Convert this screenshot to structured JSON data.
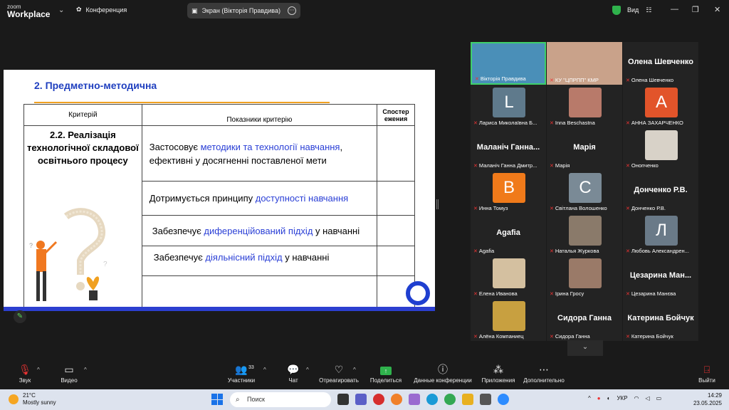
{
  "app": {
    "logo_line1": "zoom",
    "logo_line2": "Workplace",
    "meeting": "Конференция"
  },
  "share": {
    "label": "Экран (Вікторія Правдива)"
  },
  "top": {
    "view": "Вид"
  },
  "slide": {
    "title": "2. Предметно-методична",
    "headers": [
      "Критерій",
      "Показники критерію",
      "Спостер ежения"
    ],
    "criterion": "2.2. Реалізація технологічної складової освітнього процесу",
    "rows": [
      {
        "pre": "Застосовує ",
        "hl": "методики та технології навчання",
        "post": ", ефективні у досягненні поставленої мети"
      },
      {
        "pre": "Дотримується принципу ",
        "hl": "доступності навчання",
        "post": ""
      },
      {
        "pre": "Забезпечує ",
        "hl": "диференційований підхід",
        "post": " у навчанні"
      },
      {
        "pre": "Забезпечує ",
        "hl": "діяльнісний підхід",
        "post": " у навчанні"
      }
    ]
  },
  "participants": [
    {
      "name": "Вікторія Правдива",
      "kind": "photo",
      "color": "#4a8fb8",
      "active": true
    },
    {
      "name": "КУ \"ЦПРПП\" КМР",
      "kind": "photo",
      "color": "#c9a28a"
    },
    {
      "name": "Олена Шевченко",
      "kind": "big",
      "big": "Олена Шевченко"
    },
    {
      "name": "Лариса Миколаївна Б...",
      "kind": "avatar",
      "letter": "L",
      "color": "#5f7a8c"
    },
    {
      "name": "Inna Beschastna",
      "kind": "photo",
      "color": "#b87a6a"
    },
    {
      "name": "АННА ЗАХАРЧЕНКО",
      "kind": "avatar",
      "letter": "A",
      "color": "#e2542a"
    },
    {
      "name": "Маланіч Ганна Дмитр...",
      "kind": "big",
      "big": "Маланіч Ганна..."
    },
    {
      "name": "Марія",
      "kind": "big",
      "big": "Марія"
    },
    {
      "name": "Онопченко",
      "kind": "photo",
      "color": "#d8d2c8"
    },
    {
      "name": "Инна Томуз",
      "kind": "avatar",
      "letter": "B",
      "color": "#f07a1a"
    },
    {
      "name": "Світлана Волошенко",
      "kind": "avatar",
      "letter": "C",
      "color": "#7a8a96"
    },
    {
      "name": "Донченко Р.В.",
      "kind": "big",
      "big": "Донченко Р.В."
    },
    {
      "name": "Agafia",
      "kind": "big",
      "big": "Agafia"
    },
    {
      "name": "Наталья Журкова",
      "kind": "photo",
      "color": "#8a7a6a"
    },
    {
      "name": "Любовь Александрен...",
      "kind": "avatar",
      "letter": "Л",
      "color": "#6a7a88"
    },
    {
      "name": "Елена Иванова",
      "kind": "photo",
      "color": "#d4c0a0"
    },
    {
      "name": "Ірина Гросу",
      "kind": "photo",
      "color": "#9a7a68"
    },
    {
      "name": "Цезарина Манєва",
      "kind": "big",
      "big": "Цезарина Ман..."
    },
    {
      "name": "Алёна Компаниец",
      "kind": "photo",
      "color": "#c8a040"
    },
    {
      "name": "Сидора Ганна",
      "kind": "big",
      "big": "Сидора Ганна"
    },
    {
      "name": "Катерина Бойчук",
      "kind": "big",
      "big": "Катерина Бойчук"
    }
  ],
  "toolbar": {
    "audio": "Звук",
    "video": "Видео",
    "participants": "Участники",
    "participants_count": "33",
    "chat": "Чат",
    "react": "Отреагировать",
    "share": "Поделиться",
    "info": "Данные конференции",
    "apps": "Приложения",
    "more": "Дополнительно",
    "leave": "Выйти"
  },
  "taskbar": {
    "temp": "21°C",
    "weather": "Mostly sunny",
    "search": "Поиск",
    "lang": "УКР",
    "time": "14:29",
    "date": "23.05.2025"
  }
}
